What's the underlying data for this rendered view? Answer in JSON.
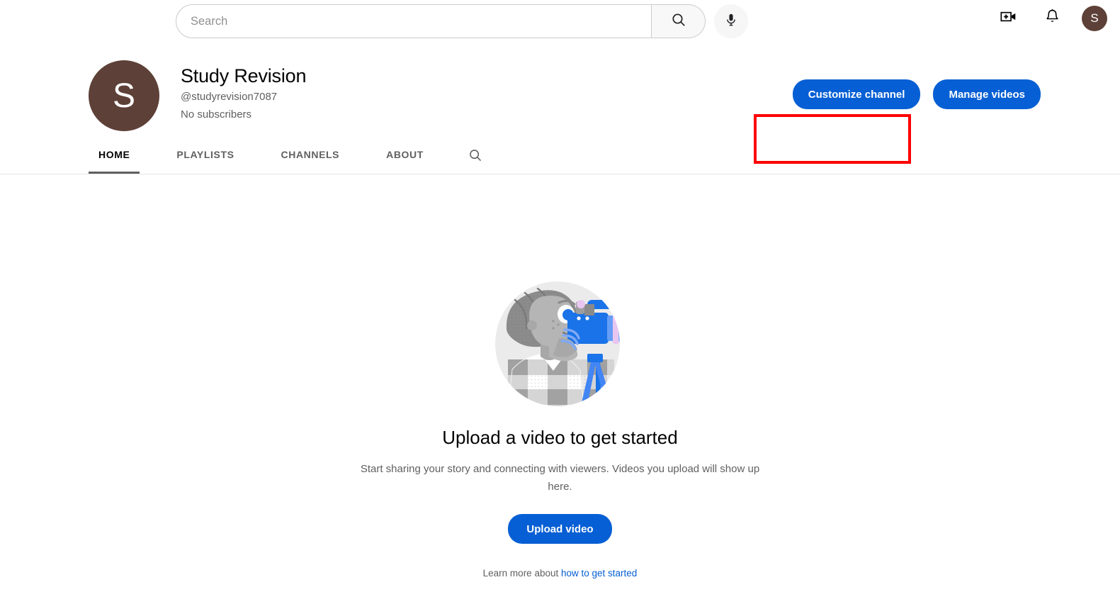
{
  "masthead": {
    "search": {
      "placeholder": "Search",
      "value": "",
      "search_icon": "search-icon",
      "mic_icon": "microphone-icon"
    },
    "create_icon": "create-video-icon",
    "notifications_icon": "bell-icon",
    "account_avatar_letter": "S",
    "account_avatar_color": "#5d4037"
  },
  "channel": {
    "avatar_letter": "S",
    "avatar_color": "#5d4037",
    "title": "Study Revision",
    "handle": "@studyrevision7087",
    "subscribers": "No subscribers",
    "customize_label": "Customize channel",
    "manage_label": "Manage videos",
    "button_color": "#065fd4",
    "highlight_color": "#ff0000"
  },
  "tabs": [
    {
      "label": "HOME",
      "active": true
    },
    {
      "label": "PLAYLISTS",
      "active": false
    },
    {
      "label": "CHANNELS",
      "active": false
    },
    {
      "label": "ABOUT",
      "active": false
    }
  ],
  "tab_search_icon": "search-icon",
  "empty_state": {
    "illustration": "person-filming-with-camera-illustration",
    "title": "Upload a video to get started",
    "description": "Start sharing your story and connecting with viewers. Videos you upload will show up here.",
    "upload_label": "Upload video",
    "learn_prefix": "Learn more about",
    "learn_link": "how to get started"
  }
}
